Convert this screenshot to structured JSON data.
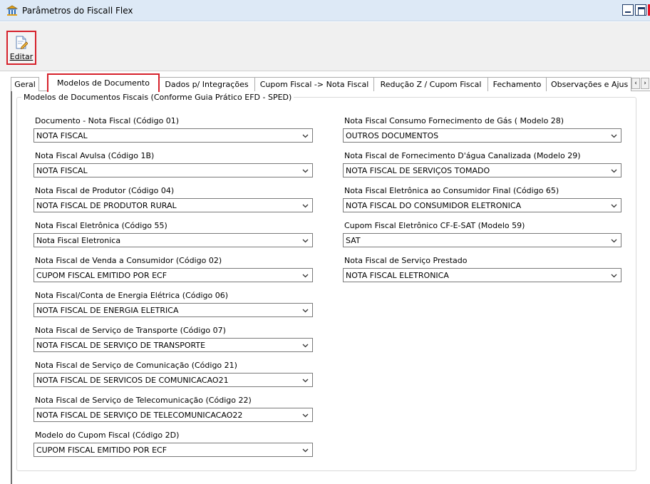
{
  "window": {
    "title": "Parâmetros do Fiscall Flex",
    "app_icon": "building-columns-icon",
    "controls": [
      "minimize-icon",
      "maximize-icon",
      "close-icon"
    ]
  },
  "toolbar": {
    "edit_label": "Editar",
    "edit_icon": "document-edit-icon"
  },
  "tabs": [
    {
      "label": "Geral",
      "active": false
    },
    {
      "label": "Modelos de Documento",
      "active": true
    },
    {
      "label": "Dados p/ Integrações",
      "active": false
    },
    {
      "label": "Cupom Fiscal -> Nota Fiscal",
      "active": false
    },
    {
      "label": "Redução Z / Cupom Fiscal",
      "active": false
    },
    {
      "label": "Fechamento",
      "active": false
    },
    {
      "label": "Observações e Ajus",
      "active": false
    }
  ],
  "tab_scroll": {
    "left": "‹",
    "right": "›"
  },
  "group": {
    "title": "Modelos de Documentos Fiscais (Conforme Guia Prático EFD - SPED)"
  },
  "fields_left": [
    {
      "label": "Documento - Nota Fiscal (Código 01)",
      "value": "NOTA FISCAL"
    },
    {
      "label": "Nota Fiscal Avulsa (Código 1B)",
      "value": "NOTA FISCAL"
    },
    {
      "label": "Nota Fiscal de Produtor (Código 04)",
      "value": "NOTA FISCAL DE PRODUTOR RURAL"
    },
    {
      "label": "Nota Fiscal Eletrônica (Código 55)",
      "value": "Nota Fiscal Eletronica"
    },
    {
      "label": "Nota Fiscal de Venda a Consumidor (Código 02)",
      "value": "CUPOM FISCAL EMITIDO POR ECF"
    },
    {
      "label": "Nota Fiscal/Conta de Energia Elétrica (Código 06)",
      "value": "NOTA FISCAL DE ENERGIA ELETRICA"
    },
    {
      "label": "Nota Fiscal de Serviço de Transporte (Código 07)",
      "value": "NOTA FISCAL DE SERVIÇO DE TRANSPORTE"
    },
    {
      "label": "Nota Fiscal de Serviço de Comunicação (Código 21)",
      "value": "NOTA FISCAL DE SERVICOS DE COMUNICACAO21"
    },
    {
      "label": "Nota Fiscal de Serviço de Telecomunicação (Código 22)",
      "value": "NOTA FISCAL DE SERVIÇO DE TELECOMUNICACAO22"
    },
    {
      "label": "Modelo do Cupom Fiscal (Código 2D)",
      "value": "CUPOM FISCAL EMITIDO POR ECF"
    }
  ],
  "fields_right": [
    {
      "label": "Nota Fiscal Consumo Fornecimento de Gás ( Modelo 28)",
      "value": "OUTROS DOCUMENTOS"
    },
    {
      "label": "Nota Fiscal de Fornecimento D'água Canalizada (Modelo 29)",
      "value": "NOTA FISCAL DE SERVIÇOS TOMADO"
    },
    {
      "label": "Nota Fiscal Eletrônica ao Consumidor Final (Código 65)",
      "value": "NOTA FISCAL DO CONSUMIDOR ELETRONICA"
    },
    {
      "label": "Cupom Fiscal Eletrônico CF-E-SAT (Modelo 59)",
      "value": "SAT"
    },
    {
      "label": "Nota Fiscal de Serviço Prestado",
      "value": "NOTA FISCAL ELETRONICA"
    }
  ],
  "colors": {
    "highlight": "#d6212b",
    "titlebar": "#dde9f6",
    "toolbar": "#f0f0f0"
  }
}
